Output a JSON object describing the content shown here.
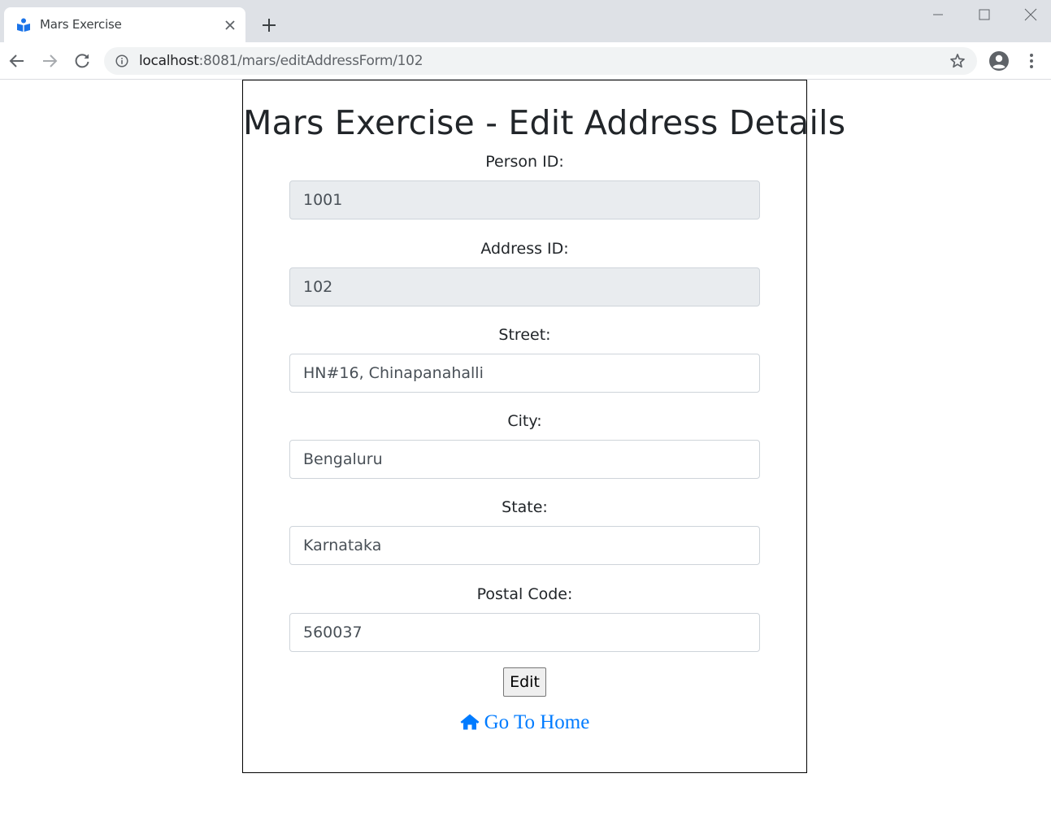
{
  "browser": {
    "tab_title": "Mars Exercise",
    "url_host": "localhost",
    "url_path": ":8081/mars/editAddressForm/102"
  },
  "page": {
    "title": "Mars Exercise - Edit Address Details",
    "fields": {
      "person_id": {
        "label": "Person ID:",
        "value": "1001"
      },
      "address_id": {
        "label": "Address ID:",
        "value": "102"
      },
      "street": {
        "label": "Street:",
        "value": "HN#16, Chinapanahalli"
      },
      "city": {
        "label": "City:",
        "value": "Bengaluru"
      },
      "state": {
        "label": "State:",
        "value": "Karnataka"
      },
      "postal_code": {
        "label": "Postal Code:",
        "value": "560037"
      }
    },
    "edit_label": "Edit",
    "home_link_label": "Go To Home"
  },
  "colors": {
    "link": "#007bff",
    "readonly_bg": "#e9ecef",
    "text": "#212529"
  }
}
